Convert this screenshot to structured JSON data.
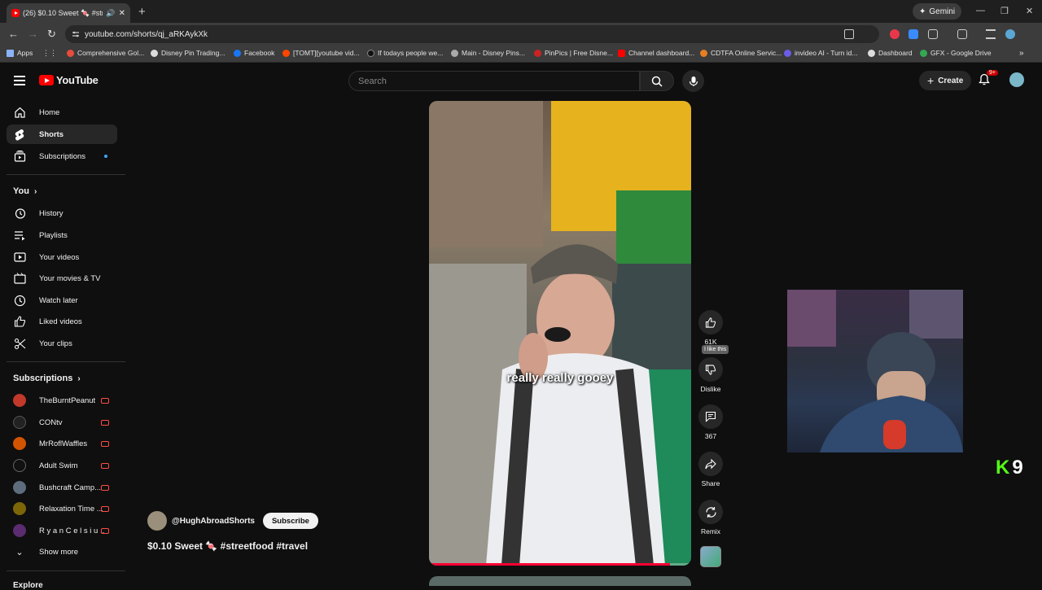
{
  "browser": {
    "tab_title": "(26) $0.10 Sweet 🍬 #stree",
    "new_tab": "+",
    "gemini_label": "Gemini",
    "url": "youtube.com/shorts/qj_aRKAykXk",
    "bookmarks": [
      {
        "label": "Apps",
        "color": "#5f6368"
      },
      {
        "label": "Comprehensive Gol...",
        "color": "#e74c3c"
      },
      {
        "label": "Disney Pin Trading...",
        "color": "#dddddd"
      },
      {
        "label": "Facebook",
        "color": "#1877f2"
      },
      {
        "label": "[TOMT][youtube vid...",
        "color": "#ff4500"
      },
      {
        "label": "If todays people we...",
        "color": "#111111"
      },
      {
        "label": "Main - Disney Pins...",
        "color": "#aaaaaa"
      },
      {
        "label": "PinPics | Free Disne...",
        "color": "#cc2222"
      },
      {
        "label": "Channel dashboard...",
        "color": "#ff0000"
      },
      {
        "label": "CDTFA Online Servic...",
        "color": "#e67e22"
      },
      {
        "label": "invideo AI - Turn id...",
        "color": "#6c5ce7"
      },
      {
        "label": "Dashboard",
        "color": "#dddddd"
      },
      {
        "label": "GFX - Google Drive",
        "color": "#34a853"
      }
    ]
  },
  "header": {
    "logo_text": "YouTube",
    "search_placeholder": "Search",
    "create_label": "Create",
    "notif_badge": "9+"
  },
  "sidebar": {
    "main": [
      {
        "label": "Home",
        "icon": "home-icon"
      },
      {
        "label": "Shorts",
        "icon": "shorts-icon"
      },
      {
        "label": "Subscriptions",
        "icon": "subscriptions-icon"
      }
    ],
    "you_heading": "You",
    "you": [
      {
        "label": "History",
        "icon": "history-icon"
      },
      {
        "label": "Playlists",
        "icon": "playlists-icon"
      },
      {
        "label": "Your videos",
        "icon": "your-videos-icon"
      },
      {
        "label": "Your movies & TV",
        "icon": "movies-icon"
      },
      {
        "label": "Watch later",
        "icon": "watch-later-icon"
      },
      {
        "label": "Liked videos",
        "icon": "liked-icon"
      },
      {
        "label": "Your clips",
        "icon": "clips-icon"
      }
    ],
    "subs_heading": "Subscriptions",
    "subs": [
      {
        "label": "TheBurntPeanut",
        "color": "#c0392b"
      },
      {
        "label": "CONtv",
        "color": "#222222"
      },
      {
        "label": "MrRoflWaffles",
        "color": "#d35400"
      },
      {
        "label": "Adult Swim",
        "color": "#111111"
      },
      {
        "label": "Bushcraft Camp...",
        "color": "#5d6d7e"
      },
      {
        "label": "Relaxation Time ...",
        "color": "#7d6608"
      },
      {
        "label": "R y a n C e l s i u ...",
        "color": "#5b2c6f"
      }
    ],
    "show_more": "Show more",
    "explore_partial": "Explore"
  },
  "short": {
    "caption": "really really gooey",
    "progress": 0.92,
    "likes": "61K",
    "tooltip": "I like this",
    "dislike_label": "Dislike",
    "comments": "367",
    "share_label": "Share",
    "remix_label": "Remix",
    "channel": "@HughAbroadShorts",
    "subscribe_label": "Subscribe",
    "title": "$0.10 Sweet 🍬 #streetfood #travel"
  },
  "overlay": {
    "kick_letter": "K",
    "kick_count": "9"
  },
  "colors": {
    "background": "#0f0f0f",
    "brand_red": "#ff0000",
    "progress": "#ff0033",
    "kick_green": "#53fc18"
  }
}
